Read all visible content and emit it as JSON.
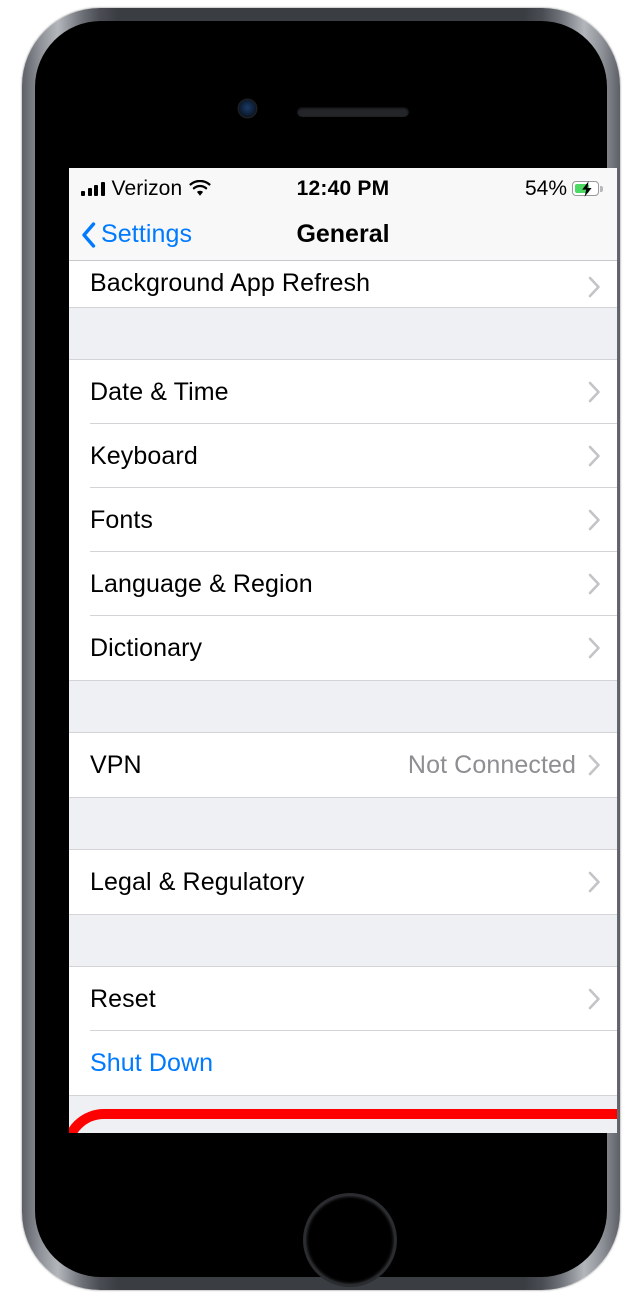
{
  "status_bar": {
    "carrier": "Verizon",
    "signal_icon": "signal-bars-icon",
    "wifi_icon": "wifi-icon",
    "time": "12:40 PM",
    "battery_percent": "54%",
    "battery_icon": "battery-charging-icon",
    "battery_level": 54,
    "charging": true,
    "battery_fill_color": "#4cd964"
  },
  "nav_bar": {
    "back_label": "Settings",
    "back_icon": "chevron-left-icon",
    "title": "General",
    "accent_color": "#007aff"
  },
  "settings_list": {
    "groups": [
      {
        "rows": [
          {
            "label": "Background App Refresh",
            "value": "",
            "accessory": "chevron-right-icon",
            "style": "default"
          }
        ]
      },
      {
        "rows": [
          {
            "label": "Date & Time",
            "value": "",
            "accessory": "chevron-right-icon",
            "style": "default"
          },
          {
            "label": "Keyboard",
            "value": "",
            "accessory": "chevron-right-icon",
            "style": "default"
          },
          {
            "label": "Fonts",
            "value": "",
            "accessory": "chevron-right-icon",
            "style": "default"
          },
          {
            "label": "Language & Region",
            "value": "",
            "accessory": "chevron-right-icon",
            "style": "default"
          },
          {
            "label": "Dictionary",
            "value": "",
            "accessory": "chevron-right-icon",
            "style": "default"
          }
        ]
      },
      {
        "rows": [
          {
            "label": "VPN",
            "value": "Not Connected",
            "accessory": "chevron-right-icon",
            "style": "default"
          }
        ]
      },
      {
        "rows": [
          {
            "label": "Legal & Regulatory",
            "value": "",
            "accessory": "chevron-right-icon",
            "style": "default"
          }
        ]
      },
      {
        "rows": [
          {
            "label": "Reset",
            "value": "",
            "accessory": "chevron-right-icon",
            "style": "default"
          },
          {
            "label": "Shut Down",
            "value": "",
            "accessory": "",
            "style": "link"
          }
        ]
      }
    ]
  },
  "annotation": {
    "type": "oval-highlight",
    "target_label": "Reset",
    "color": "#ff0000",
    "stroke_width": 10
  },
  "device": {
    "model_style": "iphone-home-button",
    "frame_color": "#3a3d42",
    "hardware": [
      "mute-switch",
      "volume-up-button",
      "volume-down-button",
      "power-button",
      "home-button",
      "front-camera",
      "earpiece-speaker"
    ]
  }
}
